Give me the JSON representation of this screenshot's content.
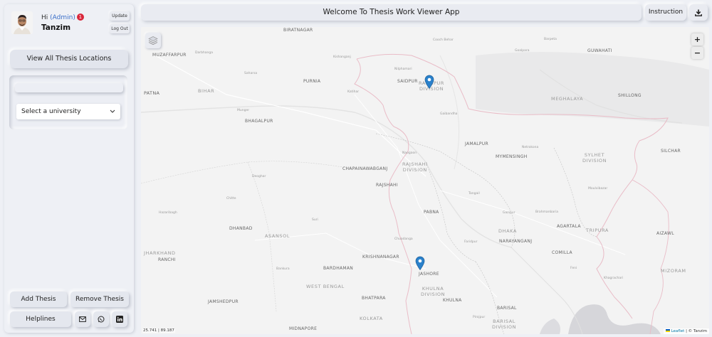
{
  "user": {
    "greeting": "Hi",
    "role": "Admin",
    "badge": "1",
    "name": "Tanzim"
  },
  "profile_buttons": {
    "update": "Update",
    "logout": "Log Out"
  },
  "sidebar": {
    "view_all": "View All Thesis Locations",
    "university_select": "Select a university",
    "add_thesis": "Add Thesis",
    "remove_thesis": "Remove Thesis",
    "helplines": "Helplines"
  },
  "header": {
    "title": "Welcome To Thesis Work Viewer App",
    "instruction": "Instruction"
  },
  "map": {
    "coords": "25.741 | 89.187",
    "attribution_leaflet": "Leaflet",
    "attribution_rest": "| © Tanzim",
    "zoom_in": "+",
    "zoom_out": "−",
    "labels": {
      "biratnagar": "BIRATNAGAR",
      "muzaffarpur": "MUZAFFARPUR",
      "darbhanga": "Darbhanga",
      "kishanganj": "Kishanganj",
      "saharsa": "Saharsa",
      "purnia": "PURNIA",
      "patna": "PATNA",
      "bihar": "BIHAR",
      "munger": "Munger",
      "bhagalpur": "BHAGALPUR",
      "katihar": "Katihar",
      "nilphamari": "Nilphamari",
      "saidpur": "SAIDPUR",
      "rangpur": "RANGPUR",
      "rangpur_div": "RANGPUR\nDIVISION",
      "gaibandha": "Gaibandha",
      "cooch_behar": "Cooch Behar",
      "barpeta": "Barpeta",
      "goalpara": "Goalpara",
      "guwahati": "GUWAHATI",
      "meghalaya": "MEGHALAYA",
      "shillong": "SHILLONG",
      "jamalpur": "JAMALPUR",
      "netrokona": "Netrokona",
      "mymensingh": "MYMENSINGH",
      "sylhet_div": "SYLHET\nDIVISION",
      "silchar": "SILCHAR",
      "naogaon": "Naogaon",
      "rajshahi_div": "RAJSHAHI\nDIVISION",
      "chapainawabganj": "CHAPAINAWABGANJ",
      "rajshahi": "RAJSHAHI",
      "deoghar": "Deoghar",
      "chitte": "Chitte",
      "tangail": "Tangail",
      "pabna": "PABNA",
      "gazipur": "Gazipur",
      "brahmanbaria": "Brahmanbaria",
      "moulvibazar": "Moulvibazar",
      "hazaribagh": "Hazaribagh",
      "dhanbad": "DHANBAD",
      "asansol": "ASANSOL",
      "suri": "Suri",
      "dhaka": "DHAKA",
      "narayanganj": "NARAYANGANJ",
      "agartala": "AGARTALA",
      "tripura": "TRIPURA",
      "aizawl": "AIZAWL",
      "chuadanga": "Chuadanga",
      "faridpur": "Faridpur",
      "comilla": "COMILLA",
      "jharkhand": "JHARKHAND",
      "ranchi": "RANCHI",
      "krishnanagar": "KRISHNANAGAR",
      "jashore": "JASHORE",
      "khulna_div": "KHULNA\nDIVISION",
      "khulna": "KHULNA",
      "bankura": "Bankura",
      "bardhaman": "BARDHAMAN",
      "west_bengal": "WEST BENGAL",
      "bhatpara": "BHATPARA",
      "jamshedpur": "JAMSHEDPUR",
      "kolkata": "KOLKATA",
      "midnapore": "MIDNAPORE",
      "barisal": "BARISAL",
      "barisal_div": "BARISAL\nDIVISION",
      "mizoram": "MIZORAM",
      "khagrachari": "Khagrachari",
      "feni": "Feni",
      "pirojpur": "Pirojpur",
      "coords_edge": "25.741 | 89.187"
    }
  },
  "colors": {
    "marker": "#2a81cb",
    "border_pink": "#e7b8c3",
    "water": "#d4d4d8",
    "badge": "#d9263a"
  }
}
